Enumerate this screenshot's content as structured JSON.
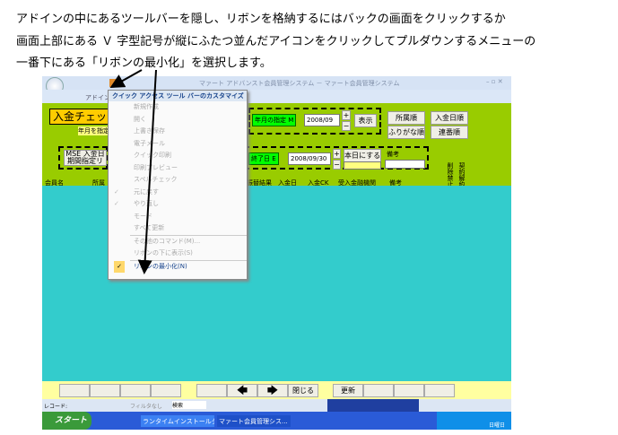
{
  "instructions": [
    "アドインの中にあるツールバーを隠し、リボンを格納するにはバックの画面をクリックするか",
    "画面上部にある Ｖ 字型記号が縦にふたつ並んだアイコンをクリックしてプルダウンするメニューの",
    "一番下にある「リボンの最小化」を選択します。"
  ],
  "window": {
    "title": "マァート アドバンスト会員管理システム － マァート会員管理システム",
    "ribbon_tab": "アドイン"
  },
  "form": {
    "title": "入金チェック",
    "hint": "年月を指定し、表示ボタンを押",
    "list_button": "MSE 入金日期間指定リスト",
    "year_month_label": "年月の指定 M",
    "year_month_value": "2008/09",
    "show_button": "表示",
    "sort_buttons": [
      "所属順",
      "入金日順",
      "ふりがな順",
      "連番順"
    ],
    "end_date_label": "終了日 E",
    "end_date_value": "2008/09/30",
    "today_button": "本日にする",
    "memo_label": "備考",
    "vertical_labels": [
      "削除禁止",
      "契約解約"
    ]
  },
  "columns": [
    "会員名",
    "所属",
    "振替結果",
    "入金日",
    "入金CK",
    "受入金融機関",
    "備考"
  ],
  "menu": {
    "header": "クイック アクセス ツール バーのカスタマイズ",
    "items": [
      {
        "label": "新規作成",
        "checked": false
      },
      {
        "label": "開く",
        "checked": false
      },
      {
        "label": "上書き保存",
        "checked": false
      },
      {
        "label": "電子メール",
        "checked": false
      },
      {
        "label": "クイック印刷",
        "checked": false
      },
      {
        "label": "印刷プレビュー",
        "checked": false
      },
      {
        "label": "スペルチェック",
        "checked": false
      },
      {
        "label": "元に戻す",
        "checked": true
      },
      {
        "label": "やり直し",
        "checked": true
      },
      {
        "label": "モード",
        "checked": false
      },
      {
        "label": "すべて更新",
        "checked": false
      },
      {
        "label": "その他のコマンド(M)...",
        "checked": false
      },
      {
        "label": "リボンの下に表示(S)",
        "checked": false
      },
      {
        "label": "リボンの最小化(N)",
        "checked": true
      }
    ]
  },
  "bottom_buttons": {
    "close": "閉じる",
    "refresh": "更新",
    "prev_icon": "arrow-left-icon",
    "next_icon": "arrow-right-icon"
  },
  "statusbar": {
    "record": "レコード:",
    "filter": "フィルタなし",
    "search": "検索"
  },
  "taskbar": {
    "start": "スタート",
    "tasks": [
      "ランタイムインストールタ...",
      "マァート会員管理シス..."
    ],
    "clock": "日曜日"
  }
}
